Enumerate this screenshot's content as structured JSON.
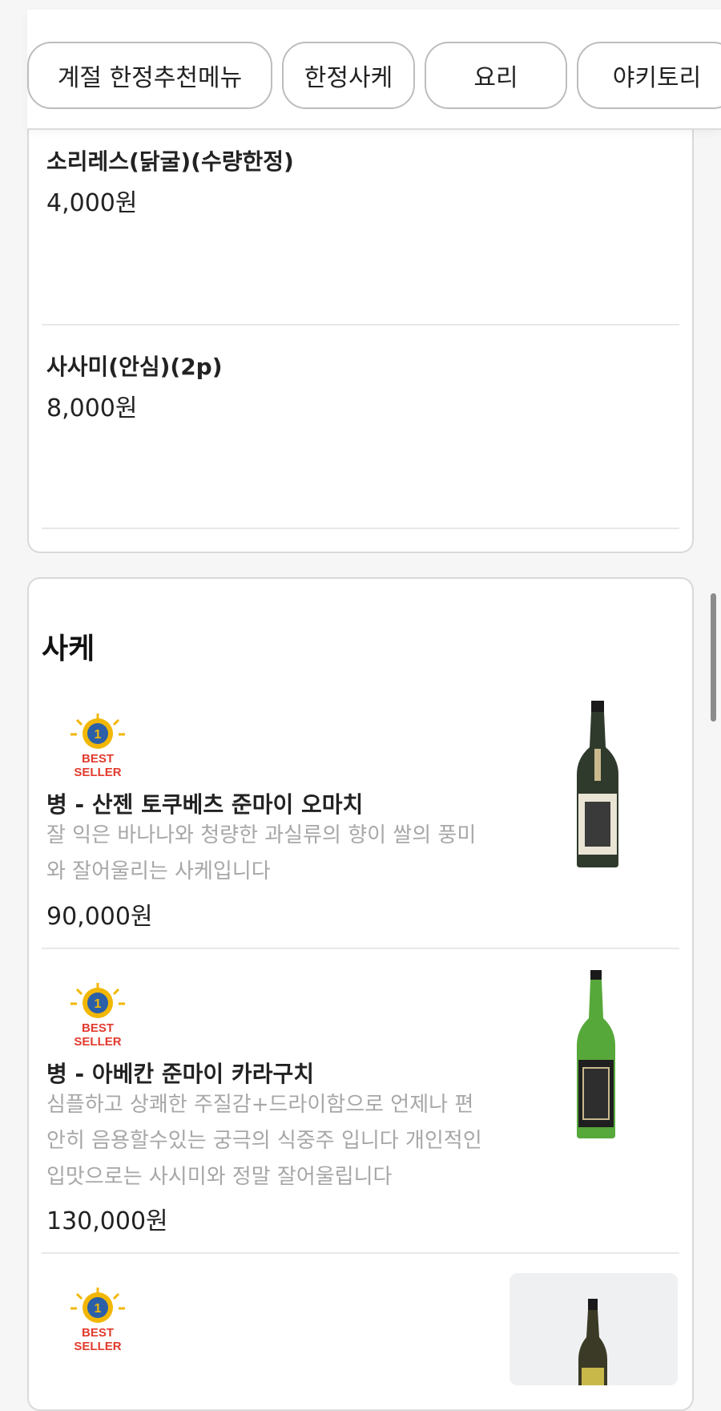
{
  "tabs": [
    {
      "label": "계절 한정추천메뉴"
    },
    {
      "label": "한정사케"
    },
    {
      "label": "요리"
    },
    {
      "label": "야키토리"
    }
  ],
  "limited_menu": {
    "items": [
      {
        "name": "소리레스(닭굴)(수량한정)",
        "price": "4,000원"
      },
      {
        "name": "사사미(안심)(2p)",
        "price": "8,000원"
      }
    ]
  },
  "sake": {
    "title": "사케",
    "items": [
      {
        "badge_line1": "BEST",
        "badge_line2": "SELLER",
        "badge_number": "1",
        "name": "병 - 산젠 토쿠베츠 준마이 오마치",
        "desc_line1": "잘 익은 바나나와 청량한 과실류의 향이 쌀의 풍미",
        "desc_line2": "와 잘어울리는 사케입니다",
        "price": "90,000원"
      },
      {
        "badge_line1": "BEST",
        "badge_line2": "SELLER",
        "badge_number": "1",
        "name": "병 - 아베칸 준마이 카라구치",
        "desc_line1": "심플하고 상쾌한 주질감+드라이함으로 언제나 편",
        "desc_line2": "안히 음용할수있는 궁극의 식중주 입니다 개인적인",
        "desc_line3": "입맛으로는 사시미와 정말 잘어울립니다",
        "price": "130,000원"
      },
      {
        "badge_line1": "BEST",
        "badge_line2": "SELLER",
        "badge_number": "1"
      }
    ]
  },
  "colors": {
    "badge_gold": "#f2b705",
    "badge_red": "#e23b2e",
    "bottle_dark": "#2f3a2c",
    "bottle_green": "#57a83a"
  }
}
